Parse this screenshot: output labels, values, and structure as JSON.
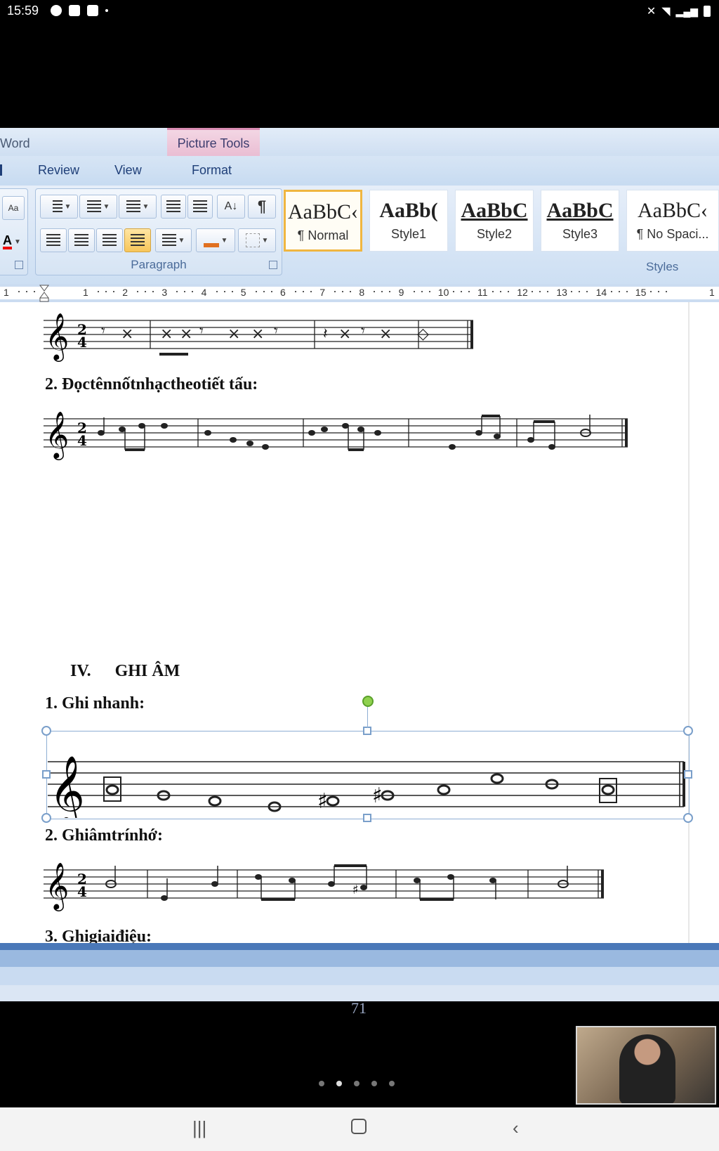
{
  "status_bar": {
    "time": "15:59"
  },
  "word": {
    "app_title": "Word",
    "picture_tools": "Picture Tools",
    "tabs": [
      "Review",
      "View",
      "Format"
    ],
    "paragraph_group_label": "Paragraph",
    "styles_group_label": "Styles",
    "styles": [
      {
        "sample": "AaBbC‹",
        "name": "¶ Normal",
        "selected": true
      },
      {
        "sample": "AaBb(",
        "name": "Style1",
        "selected": false
      },
      {
        "sample": "AaBbC",
        "name": "Style2",
        "selected": false
      },
      {
        "sample": "AaBbC",
        "name": "Style3",
        "selected": false
      },
      {
        "sample": "AaBbC‹",
        "name": "¶ No Spaci...",
        "selected": false
      }
    ],
    "ruler_numbers": [
      "1",
      "1",
      "2",
      "3",
      "4",
      "5",
      "6",
      "7",
      "8",
      "9",
      "10",
      "11",
      "12",
      "13",
      "14",
      "15",
      "1"
    ]
  },
  "document": {
    "heading_doc_ten_not": "2. Đọctênnốtnhạctheotiết tấu:",
    "section_heading_num": "IV.",
    "section_heading_text": "GHI ÂM",
    "sub1": "1. Ghi nhanh:",
    "sub2": "2. Ghiâmtrínhớ:",
    "sub3": "3. Ghigiaiđiệu:",
    "page_number": "71",
    "time_signature_top": "2",
    "time_signature_bottom": "4"
  },
  "accent_colors": {
    "ribbon_text": "#1f3f78",
    "picture_tools": "#e9bcd2",
    "selected_style_border": "#f0b640",
    "selection_border": "#8eaed4",
    "rotate_handle": "#8fd14f"
  },
  "icons": [
    "bullets-icon",
    "numbering-icon",
    "multilevel-list-icon",
    "decrease-indent-icon",
    "increase-indent-icon",
    "sort-icon",
    "pilcrow-icon",
    "align-left-icon",
    "align-center-icon",
    "align-right-icon",
    "justify-icon",
    "line-spacing-icon",
    "shading-icon",
    "borders-icon",
    "font-color-icon",
    "treble-clef-icon"
  ],
  "pager": {
    "pages": 5,
    "active_index": 1
  }
}
